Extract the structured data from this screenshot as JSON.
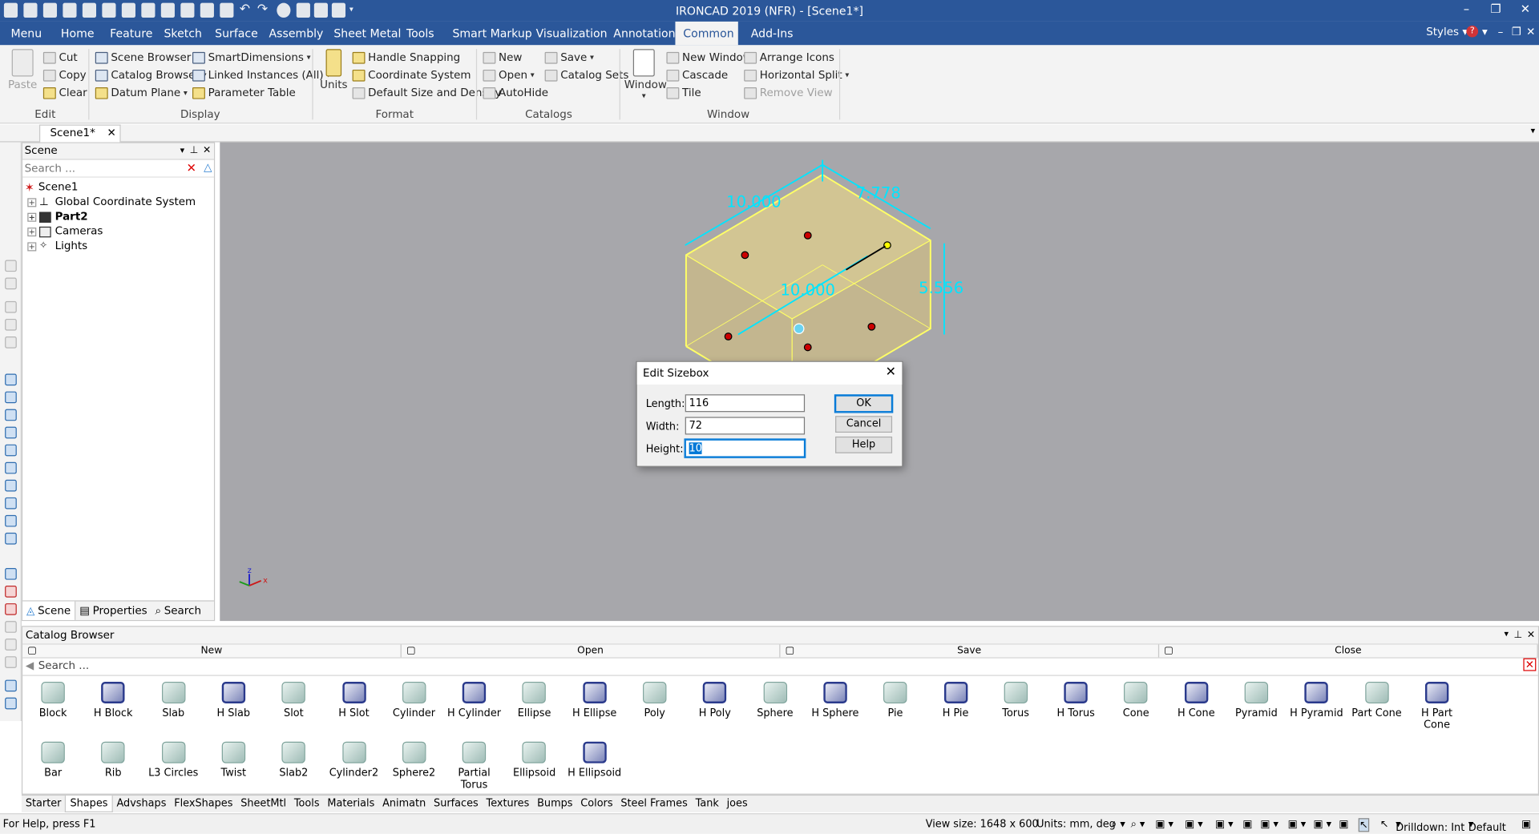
{
  "app": {
    "title": "IRONCAD 2019 (NFR) - [Scene1*]"
  },
  "menu_tabs": [
    "Menu",
    "Home",
    "Feature",
    "Sketch",
    "Surface",
    "Assembly",
    "Sheet Metal",
    "Tools",
    "Smart Markup",
    "Visualization",
    "Annotation",
    "Common",
    "Add-Ins"
  ],
  "active_tab": "Common",
  "styles_label": "Styles",
  "ribbon": {
    "edit": {
      "paste": "Paste",
      "cut": "Cut",
      "copy": "Copy",
      "clear": "Clear",
      "group": "Edit"
    },
    "display": {
      "scene_browser": "Scene Browser",
      "catalog_browser": "Catalog Browser",
      "datum_plane": "Datum Plane",
      "smart_dimensions": "SmartDimensions",
      "linked_instances": "Linked Instances (All)",
      "parameter_table": "Parameter Table",
      "group": "Display"
    },
    "format": {
      "units": "Units",
      "handle_snapping": "Handle Snapping",
      "coordinate_system": "Coordinate System",
      "default_size": "Default Size and Density",
      "group": "Format"
    },
    "catalogs": {
      "new": "New",
      "open": "Open",
      "autohide": "AutoHide",
      "save": "Save",
      "catalog_sets": "Catalog Sets",
      "group": "Catalogs"
    },
    "window": {
      "window": "Window",
      "new_window": "New Window",
      "cascade": "Cascade",
      "tile": "Tile",
      "arrange_icons": "Arrange Icons",
      "horizontal_split": "Horizontal Split",
      "remove_view": "Remove View",
      "group": "Window"
    }
  },
  "doc_tab": "Scene1*",
  "scene_panel": {
    "title": "Scene",
    "search_placeholder": "Search ...",
    "tree": [
      {
        "label": "Scene1",
        "bold": false
      },
      {
        "label": "Global Coordinate System",
        "bold": false
      },
      {
        "label": "Part2",
        "bold": true
      },
      {
        "label": "Cameras",
        "bold": false
      },
      {
        "label": "Lights",
        "bold": false
      }
    ],
    "tabs": [
      "Scene",
      "Properties",
      "Search"
    ]
  },
  "viewport": {
    "dimensions": [
      "10.000",
      "7.778",
      "10.000",
      "5.556"
    ],
    "axis_labels": [
      "z",
      "x"
    ]
  },
  "dialog": {
    "title": "Edit Sizebox",
    "length_label": "Length:",
    "length_value": "116",
    "width_label": "Width:",
    "width_value": "72",
    "height_label": "Height:",
    "height_value": "10",
    "ok": "OK",
    "cancel": "Cancel",
    "help": "Help"
  },
  "catalog": {
    "title": "Catalog Browser",
    "bar": [
      "New",
      "Open",
      "Save",
      "Close"
    ],
    "search_placeholder": "Search ...",
    "shapes_row1": [
      "Block",
      "H Block",
      "Slab",
      "H Slab",
      "Slot",
      "H Slot",
      "Cylinder",
      "H Cylinder",
      "Ellipse",
      "H Ellipse",
      "Poly",
      "H Poly",
      "Sphere",
      "H Sphere",
      "Pie",
      "H Pie",
      "Torus",
      "H Torus",
      "Cone",
      "H Cone",
      "Pyramid",
      "H Pyramid",
      "Part Cone",
      "H Part Cone"
    ],
    "shapes_row2": [
      "Bar",
      "Rib",
      "L3 Circles",
      "Twist",
      "Slab2",
      "Cylinder2",
      "Sphere2",
      "Partial Torus",
      "Ellipsoid",
      "H Ellipsoid"
    ],
    "tabs": [
      "Starter",
      "Shapes",
      "Advshaps",
      "FlexShapes",
      "SheetMtl",
      "Tools",
      "Materials",
      "Animatn",
      "Surfaces",
      "Textures",
      "Bumps",
      "Colors",
      "Steel Frames",
      "Tank",
      "joes"
    ],
    "active_tab": "Shapes"
  },
  "status": {
    "help": "For Help, press F1",
    "view_size": "View size: 1648 x 600",
    "units": "Units: mm, deg",
    "drilldown": "Drilldown: Int",
    "default": "Default"
  },
  "colors": {
    "title_bar": "#2b579a",
    "dimension": "#00e5ff",
    "sizebox": "#ffff66",
    "viewport": "#a7a7ab"
  }
}
